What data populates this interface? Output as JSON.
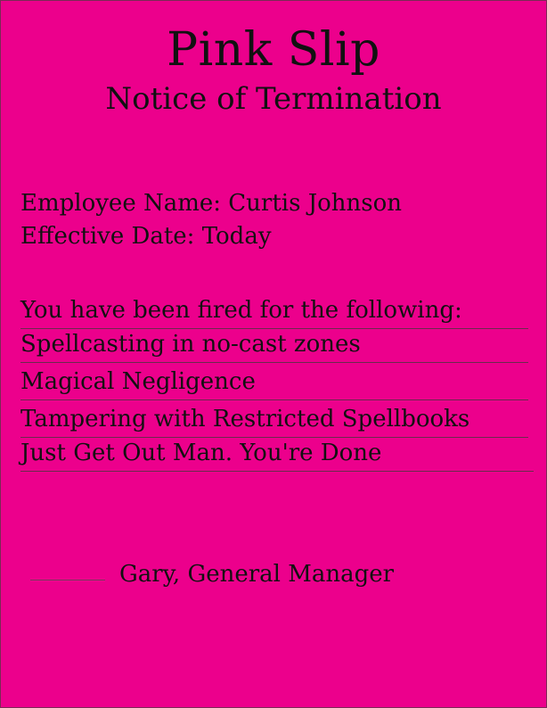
{
  "header": {
    "title": "Pink Slip",
    "subtitle": "Notice of Termination"
  },
  "employee": {
    "name_line": "Employee Name: Curtis Johnson",
    "date_line": "Effective Date: Today"
  },
  "reasons": {
    "intro": "You have been fired for the following:",
    "items": [
      "Spellcasting in no-cast zones",
      "Magical Negligence",
      "Tampering with Restricted Spellbooks",
      "Just Get Out Man. You're Done"
    ]
  },
  "signature": {
    "signer": "Gary, General Manager"
  },
  "colors": {
    "background": "#ec008c",
    "text": "#111111"
  }
}
